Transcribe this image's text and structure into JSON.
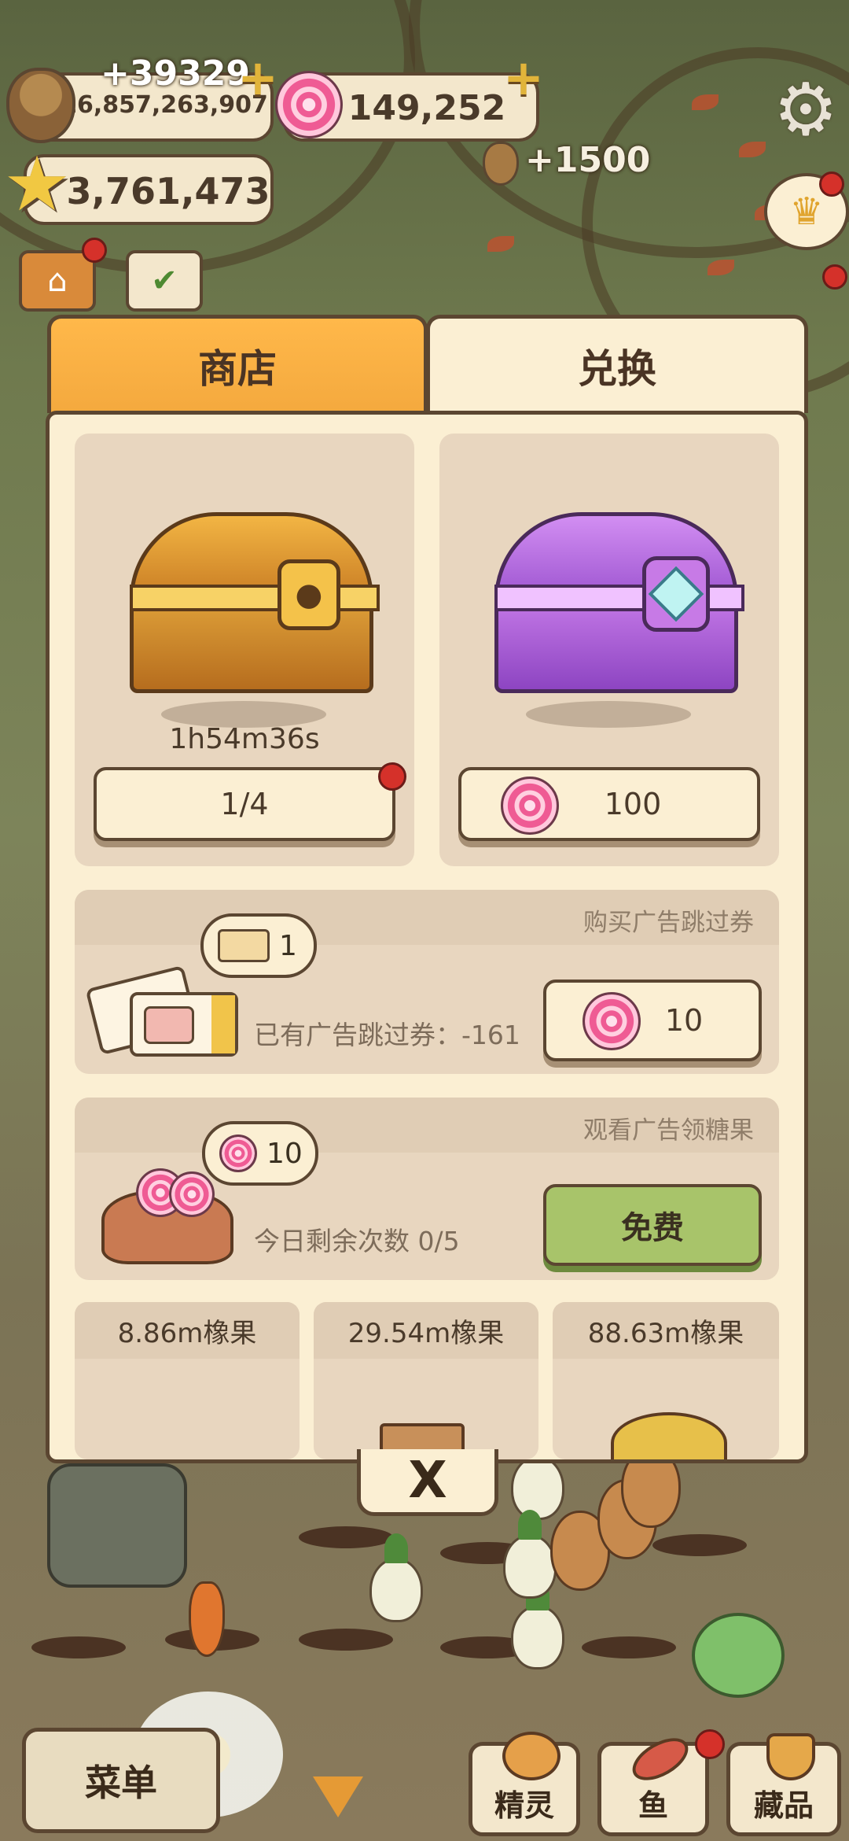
{
  "hud": {
    "acorn_gain": "+39329",
    "acorn_total": "16,857,263,907",
    "candy_total": "149,252",
    "star_total": "3,761,473",
    "floating_gain": "+1500"
  },
  "tabs": {
    "shop": "商店",
    "exchange": "兑换"
  },
  "chests": {
    "gold": {
      "timer": "1h54m36s",
      "button_label": "1/4"
    },
    "purple": {
      "price": "100"
    }
  },
  "ad_skip": {
    "title": "购买广告跳过券",
    "bubble_count": "1",
    "owned_text": "已有广告跳过券：-161",
    "price": "10"
  },
  "watch_ad": {
    "title": "观看广告领糖果",
    "bubble_count": "10",
    "remaining_text": "今日剩余次数  0/5",
    "button_label": "免费"
  },
  "acorn_offers": [
    {
      "label": "8.86m橡果"
    },
    {
      "label": "29.54m橡果"
    },
    {
      "label": "88.63m橡果"
    }
  ],
  "close_symbol": "X",
  "bottom_nav": {
    "menu": "菜单",
    "spirit": "精灵",
    "fish": "鱼",
    "collection": "藏品"
  },
  "colors": {
    "tab_active": "#f4a93e",
    "panel": "#fbefd3",
    "border": "#5b4631",
    "free_button": "#a8c46a",
    "notification": "#d5312a"
  }
}
